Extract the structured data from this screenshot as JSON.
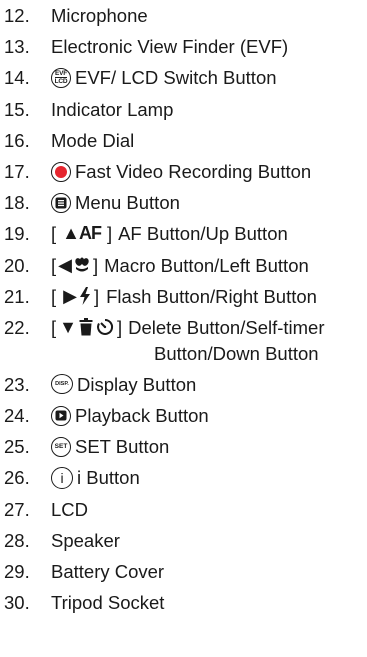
{
  "items": [
    {
      "num": "12.",
      "label": "Microphone"
    },
    {
      "num": "13.",
      "label": "Electronic View Finder (EVF)"
    },
    {
      "num": "14.",
      "label": "EVF/ LCD Switch Button",
      "icon": "evf-lcd-icon",
      "icon_text_top": "EVF",
      "icon_text_bottom": "LCD"
    },
    {
      "num": "15.",
      "label": "Indicator Lamp"
    },
    {
      "num": "16.",
      "label": "Mode Dial"
    },
    {
      "num": "17.",
      "label": "Fast Video Recording Button",
      "icon": "record-icon",
      "icon_color": "#e6262f"
    },
    {
      "num": "18.",
      "label": "Menu Button",
      "icon": "menu-icon"
    },
    {
      "num": "19.",
      "prefix": "[",
      "symbol": "▲AF",
      "suffix": "]",
      "label": "AF Button/Up Button"
    },
    {
      "num": "20.",
      "prefix": "[",
      "symbol": "◀",
      "suffix": "]",
      "label": "Macro Button/Left Button",
      "icon": "macro-flower-icon"
    },
    {
      "num": "21.",
      "prefix": "[",
      "symbol": "▶",
      "suffix": "]",
      "label": "Flash Button/Right Button",
      "icon": "flash-bolt-icon"
    },
    {
      "num": "22.",
      "prefix": "[",
      "symbol": "▼",
      "suffix": "]",
      "label": "Delete Button/Self-timer",
      "label_line2": "Button/Down Button",
      "icon": "trash-icon",
      "icon2": "self-timer-icon"
    },
    {
      "num": "23.",
      "label": "Display Button",
      "icon": "disp-icon",
      "icon_text": "DISP."
    },
    {
      "num": "24.",
      "label": "Playback Button",
      "icon": "playback-icon"
    },
    {
      "num": "25.",
      "label": "SET Button",
      "icon": "set-icon",
      "icon_text": "SET"
    },
    {
      "num": "26.",
      "label": "i Button",
      "icon": "i-icon",
      "icon_text": "i"
    },
    {
      "num": "27.",
      "label": "LCD"
    },
    {
      "num": "28.",
      "label": "Speaker"
    },
    {
      "num": "29.",
      "label": "Battery Cover"
    },
    {
      "num": "30.",
      "label": "Tripod Socket"
    }
  ],
  "colors": {
    "text": "#1a1a1a",
    "record": "#e6262f"
  }
}
